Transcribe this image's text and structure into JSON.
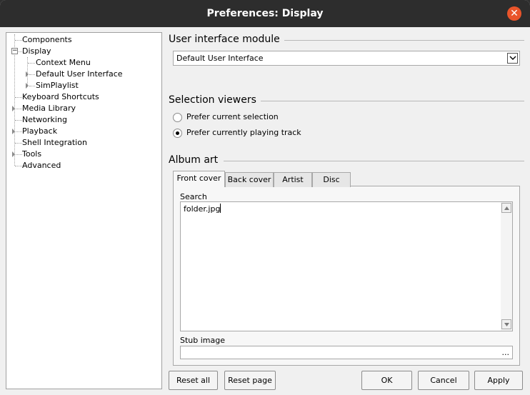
{
  "window": {
    "title": "Preferences: Display"
  },
  "tree": {
    "items": [
      {
        "label": "Components"
      },
      {
        "label": "Display"
      },
      {
        "label": "Context Menu"
      },
      {
        "label": "Default User Interface"
      },
      {
        "label": "SimPlaylist"
      },
      {
        "label": "Keyboard Shortcuts"
      },
      {
        "label": "Media Library"
      },
      {
        "label": "Networking"
      },
      {
        "label": "Playback"
      },
      {
        "label": "Shell Integration"
      },
      {
        "label": "Tools"
      },
      {
        "label": "Advanced"
      }
    ],
    "selected": "Display"
  },
  "ui_module": {
    "heading": "User interface module",
    "selected": "Default User Interface"
  },
  "selection_viewers": {
    "heading": "Selection viewers",
    "options": [
      {
        "label": "Prefer current selection",
        "checked": false
      },
      {
        "label": "Prefer currently playing track",
        "checked": true
      }
    ]
  },
  "album_art": {
    "heading": "Album art",
    "tabs": [
      {
        "label": "Front cover",
        "active": true
      },
      {
        "label": "Back cover",
        "active": false
      },
      {
        "label": "Artist",
        "active": false
      },
      {
        "label": "Disc",
        "active": false
      }
    ],
    "search_label": "Search",
    "search_value": "folder.jpg",
    "stub_label": "Stub image",
    "stub_value": "",
    "browse_label": "..."
  },
  "buttons": {
    "reset_all": "Reset all",
    "reset_page": "Reset page",
    "ok": "OK",
    "cancel": "Cancel",
    "apply": "Apply"
  },
  "colors": {
    "titlebar": "#2d2d2d",
    "close": "#e9542a",
    "background": "#f0f0f0"
  }
}
